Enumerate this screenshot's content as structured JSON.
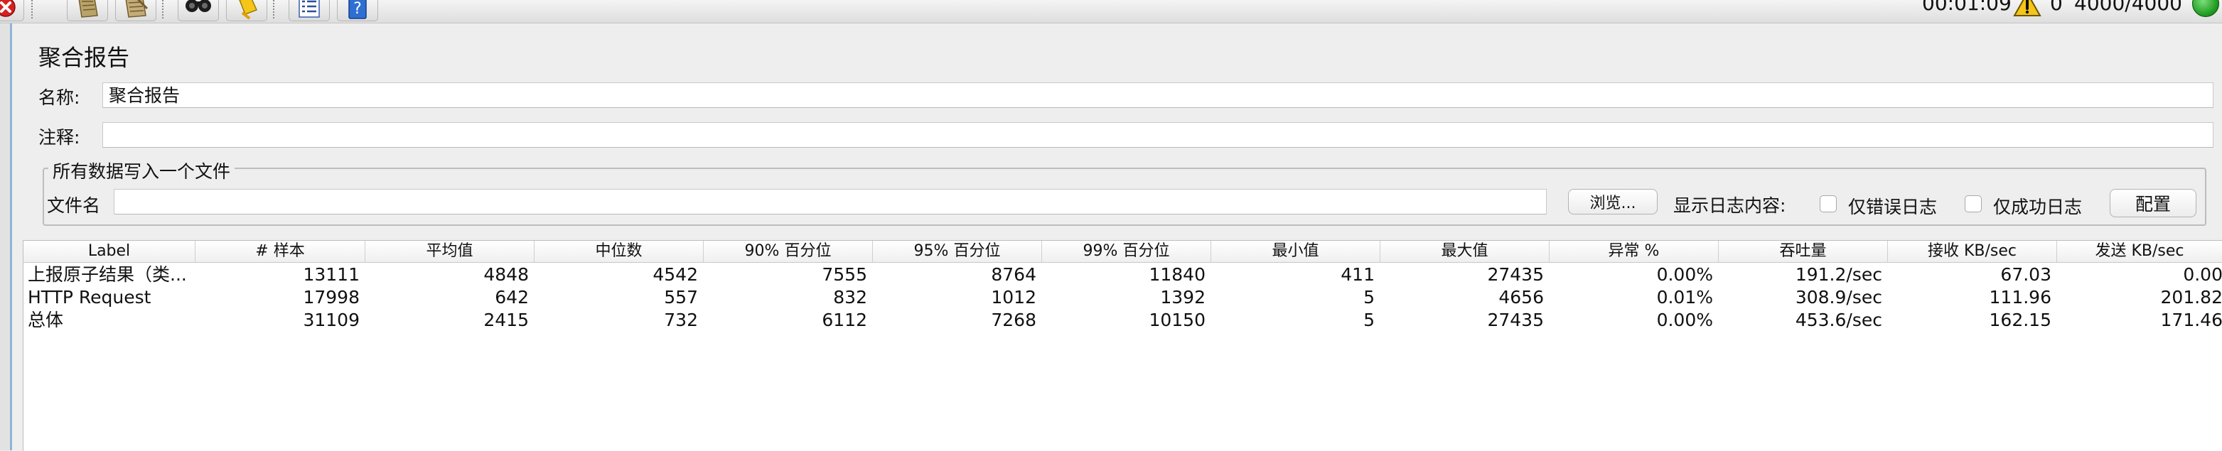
{
  "toolbar": {
    "elapsed_time": "00:01:09",
    "warning_count": "0",
    "threads": "4000/4000",
    "buttons": [
      "stop-icon",
      "broom-icon",
      "broom-all-icon",
      "binoculars-icon",
      "clear-search-icon",
      "function-helper-icon",
      "help-icon"
    ]
  },
  "page": {
    "title": "聚合报告",
    "name_label": "名称:",
    "name_value": "聚合报告",
    "comment_label": "注释:",
    "comment_value": ""
  },
  "file_group": {
    "legend": "所有数据写入一个文件",
    "filename_label": "文件名",
    "filename_value": "",
    "browse_label": "浏览...",
    "log_content_label": "显示日志内容:",
    "errors_only_label": "仅错误日志",
    "success_only_label": "仅成功日志",
    "configure_label": "配置"
  },
  "table": {
    "headers": [
      "Label",
      "# 样本",
      "平均值",
      "中位数",
      "90% 百分位",
      "95% 百分位",
      "99% 百分位",
      "最小值",
      "最大值",
      "异常 %",
      "吞吐量",
      "接收 KB/sec",
      "发送 KB/sec"
    ],
    "rows": [
      [
        "上报原子结果（类...",
        "13111",
        "4848",
        "4542",
        "7555",
        "8764",
        "11840",
        "411",
        "27435",
        "0.00%",
        "191.2/sec",
        "67.03",
        "0.00"
      ],
      [
        "HTTP Request",
        "17998",
        "642",
        "557",
        "832",
        "1012",
        "1392",
        "5",
        "4656",
        "0.01%",
        "308.9/sec",
        "111.96",
        "201.82"
      ],
      [
        "总体",
        "31109",
        "2415",
        "732",
        "6112",
        "7268",
        "10150",
        "5",
        "27435",
        "0.00%",
        "453.6/sec",
        "162.15",
        "171.46"
      ]
    ]
  }
}
